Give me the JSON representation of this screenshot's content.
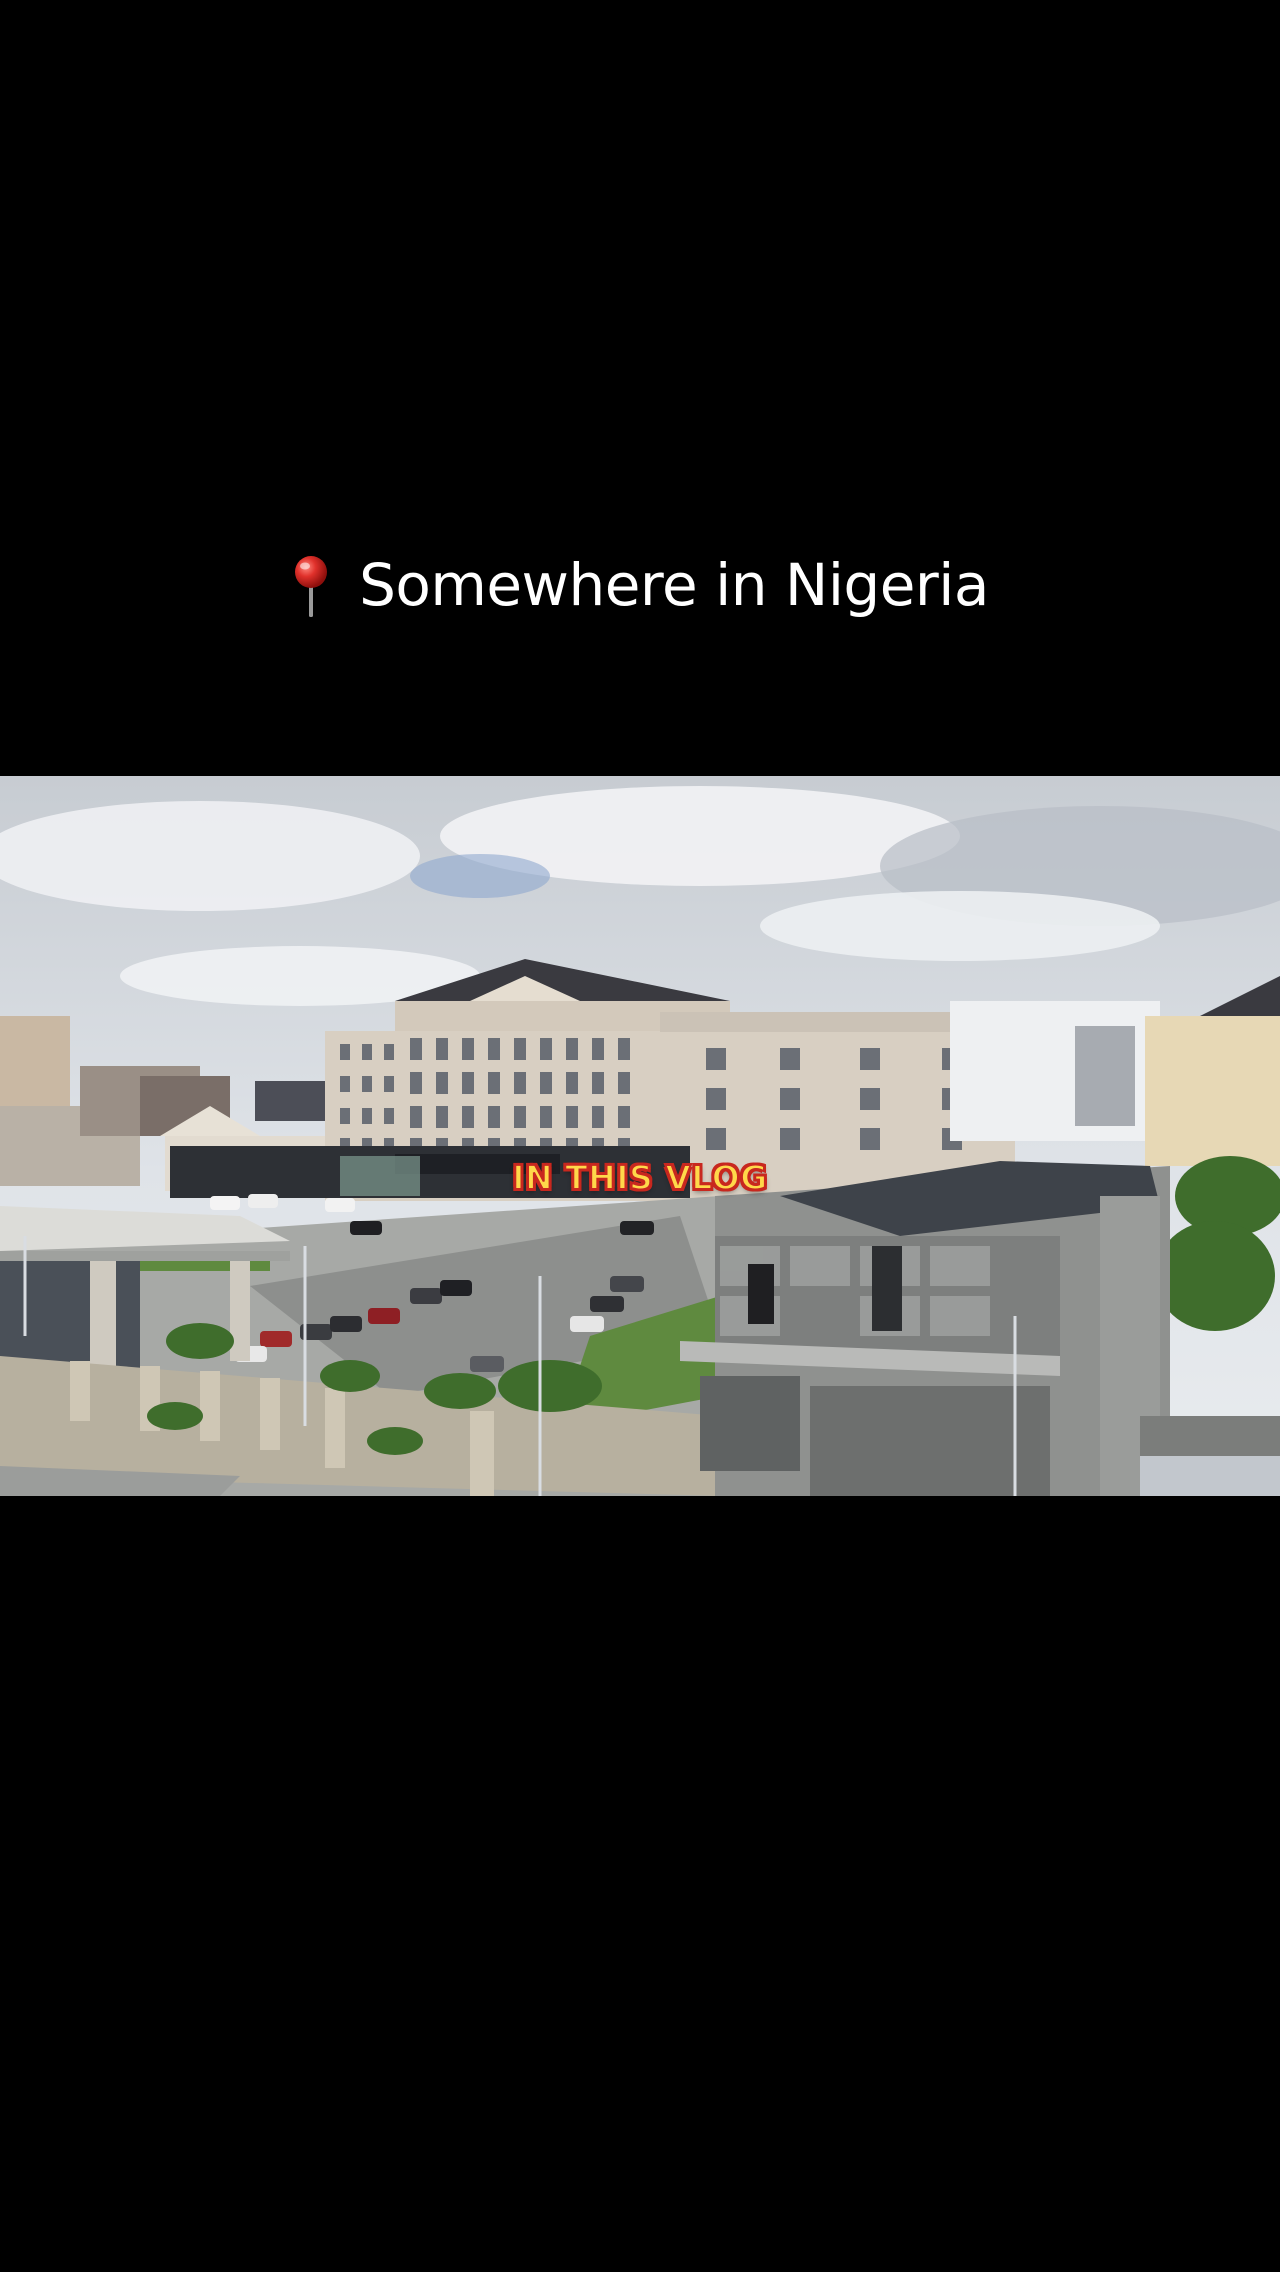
{
  "caption": {
    "icon": "round-pushpin-icon",
    "text": "Somewhere in Nigeria"
  },
  "video": {
    "overlay_text": "IN THIS VLOG",
    "scene": "city-skyline-frame"
  },
  "colors": {
    "background": "#000000",
    "caption_text": "#ffffff",
    "overlay_fill": "#ffd84a",
    "overlay_outline": "#c8281f"
  }
}
